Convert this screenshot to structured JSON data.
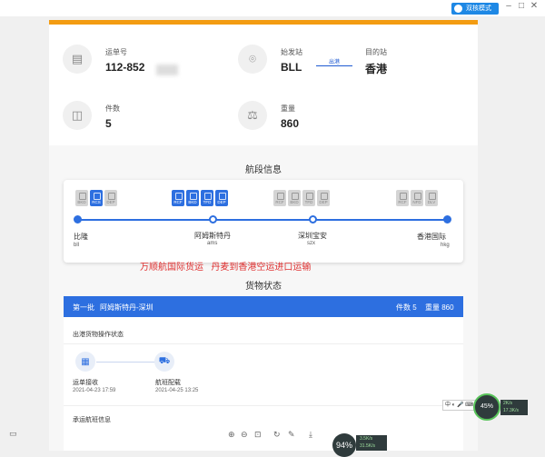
{
  "window": {
    "badge_label": "双核模式",
    "minimize": "–",
    "maximize": "□",
    "close": "✕"
  },
  "waybill": {
    "label": "运单号",
    "value": "112-852"
  },
  "origin": {
    "label": "始发站",
    "value": "BLL"
  },
  "destination": {
    "label": "目的站",
    "value": "香港"
  },
  "route_label": "出港",
  "pieces": {
    "label": "件数",
    "value": "5"
  },
  "weight": {
    "label": "重量",
    "value": "860"
  },
  "flight_section_title": "航段信息",
  "events": [
    {
      "code": "BKD",
      "active": false
    },
    {
      "code": "RCS",
      "active": true
    },
    {
      "code": "DEP",
      "active": false
    },
    {
      "code": "RCF",
      "active": true
    },
    {
      "code": "BKD",
      "active": true
    },
    {
      "code": "TFD",
      "active": true
    },
    {
      "code": "DEP",
      "active": true
    },
    {
      "code": "RCF",
      "active": false
    },
    {
      "code": "BKD",
      "active": false
    },
    {
      "code": "TFD",
      "active": false
    },
    {
      "code": "DEP",
      "active": false
    },
    {
      "code": "RCF",
      "active": false
    },
    {
      "code": "NFD",
      "active": false
    },
    {
      "code": "DLV",
      "active": false
    }
  ],
  "stops": [
    {
      "city": "比隆",
      "code": "bll"
    },
    {
      "city": "阿姆斯特丹",
      "code": "ams"
    },
    {
      "city": "深圳宝安",
      "code": "szx"
    },
    {
      "city": "香港国际",
      "code": "hkg"
    }
  ],
  "red_note": "万顺航国际货运   丹麦到香港空运进口运输",
  "cargo_section_title": "货物状态",
  "cargo": {
    "batch": "第一批",
    "route": "阿姆斯特丹-深圳",
    "pieces_text": "件数 5",
    "weight_text": "重量 860",
    "status_title": "出港货物操作状态",
    "steps": [
      {
        "label": "运单接收",
        "time": "2021-04-23 17:59"
      },
      {
        "label": "航班配载",
        "time": "2021-04-25 13:25"
      }
    ],
    "flight_info_title": "承运航班信息"
  },
  "toolbar": {
    "zoom": "94",
    "zoom_unit": "%",
    "up_speed": "3.5K/s",
    "down_speed": "31.5K/s"
  },
  "tray": {
    "ime": "中 ◐ 🎤 ⌨",
    "cpu": "45%",
    "net_up": "2K/s",
    "net_down": "17.3K/s"
  },
  "colors": {
    "primary": "#2d6fe0",
    "accent": "#f39c12",
    "note": "#e03030"
  }
}
